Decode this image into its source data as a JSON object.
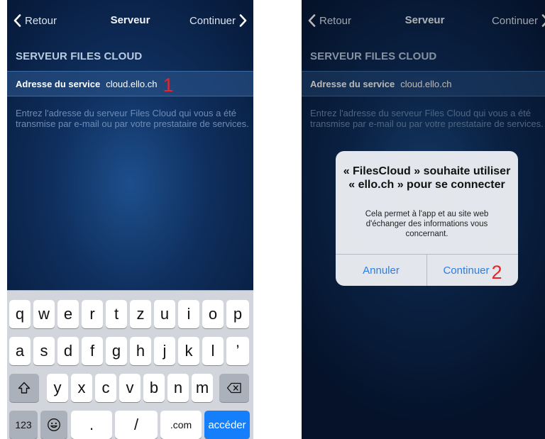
{
  "left_screen": {
    "nav": {
      "back": "Retour",
      "title": "Serveur",
      "continue": "Continuer"
    },
    "section_title": "SERVEUR FILES CLOUD",
    "address": {
      "label": "Adresse du service",
      "value": "cloud.ello.ch",
      "step": "1"
    },
    "help": "Entrez l'adresse du serveur Files Cloud qui vous a été transmise par e-mail ou par votre prestataire de services.",
    "keyboard": {
      "row1": [
        "q",
        "w",
        "e",
        "r",
        "t",
        "z",
        "u",
        "i",
        "o",
        "p"
      ],
      "row2": [
        "a",
        "s",
        "d",
        "f",
        "g",
        "h",
        "j",
        "k",
        "l",
        "’"
      ],
      "row3": [
        "y",
        "x",
        "c",
        "v",
        "b",
        "n",
        "m"
      ],
      "numbers": "123",
      "dot": ".",
      "slash": "/",
      "dotcom": ".com",
      "go": "accéder"
    }
  },
  "right_screen": {
    "nav": {
      "back": "Retour",
      "title": "Serveur",
      "continue": "Continuer"
    },
    "section_title": "SERVEUR FILES CLOUD",
    "address": {
      "label": "Adresse du service",
      "value": "cloud.ello.ch"
    },
    "help": "Entrez l'adresse du serveur Files Cloud qui vous a été transmise par e-mail ou par votre prestataire de services.",
    "alert": {
      "title": "« FilesCloud » souhaite utiliser « ello.ch » pour se connecter",
      "message": "Cela permet à l'app et au site web d'échanger des informations vous concernant.",
      "cancel": "Annuler",
      "confirm": "Continuer",
      "step": "2"
    }
  },
  "colors": {
    "accent_blue": "#147efb",
    "step_red": "#e3262b",
    "bg_navy": "#0f2f5e"
  }
}
